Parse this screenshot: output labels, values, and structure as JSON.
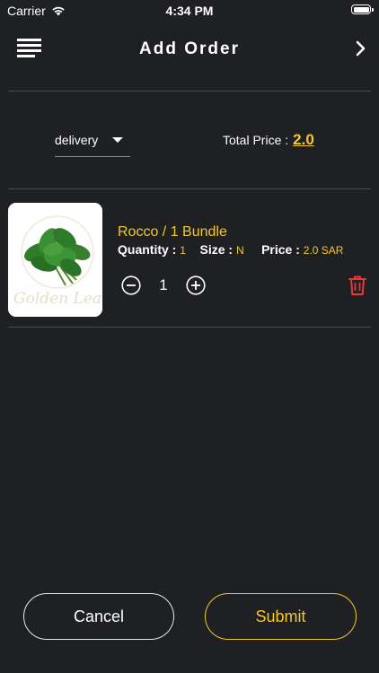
{
  "status_bar": {
    "carrier": "Carrier",
    "time": "4:34 PM"
  },
  "header": {
    "title": "Add Order",
    "menu_icon": "menu-lines-icon",
    "forward_icon": "chevron-right-icon"
  },
  "order": {
    "delivery_option": "delivery",
    "total_label": "Total Price :",
    "total_value": "2.0"
  },
  "items": [
    {
      "title": "Rocco / 1 Bundle",
      "quantity_label": "Quantity :",
      "quantity_value": "1",
      "size_label": "Size :",
      "size_value": "N",
      "price_label": "Price :",
      "price_value": "2.0 SAR",
      "stepper_value": "1",
      "image_watermark": "Golden Leaves"
    }
  ],
  "buttons": {
    "cancel": "Cancel",
    "submit": "Submit"
  },
  "colors": {
    "background": "#1f2024",
    "accent": "#f3c72a",
    "danger": "#e53935",
    "divider": "#4a4b50"
  }
}
